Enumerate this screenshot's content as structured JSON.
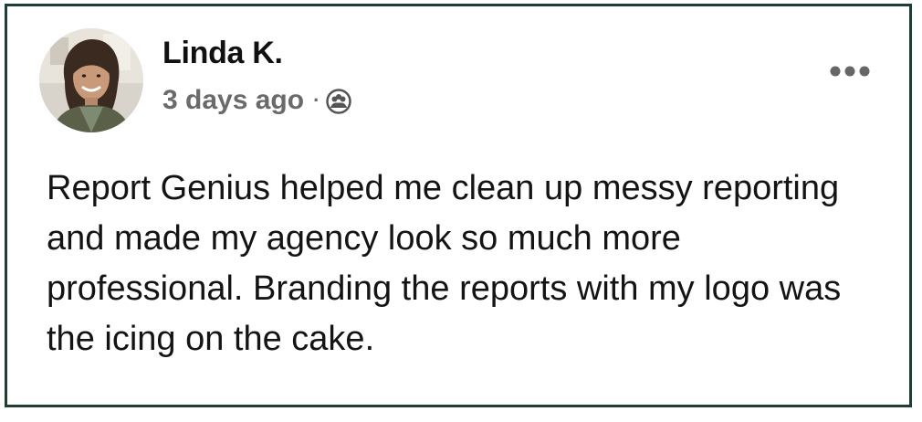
{
  "post": {
    "author_name": "Linda K.",
    "timestamp": "3 days ago",
    "separator": "·",
    "audience_icon": "friends-icon",
    "menu_icon": "more-options-icon",
    "body": "Report Genius helped me clean up messy reporting and made my agency look so much more professional. Branding the reports with my logo was the icing on the cake."
  },
  "colors": {
    "border": "#1f4030",
    "name": "#111111",
    "meta": "#6a6a6a",
    "body": "#141414"
  }
}
